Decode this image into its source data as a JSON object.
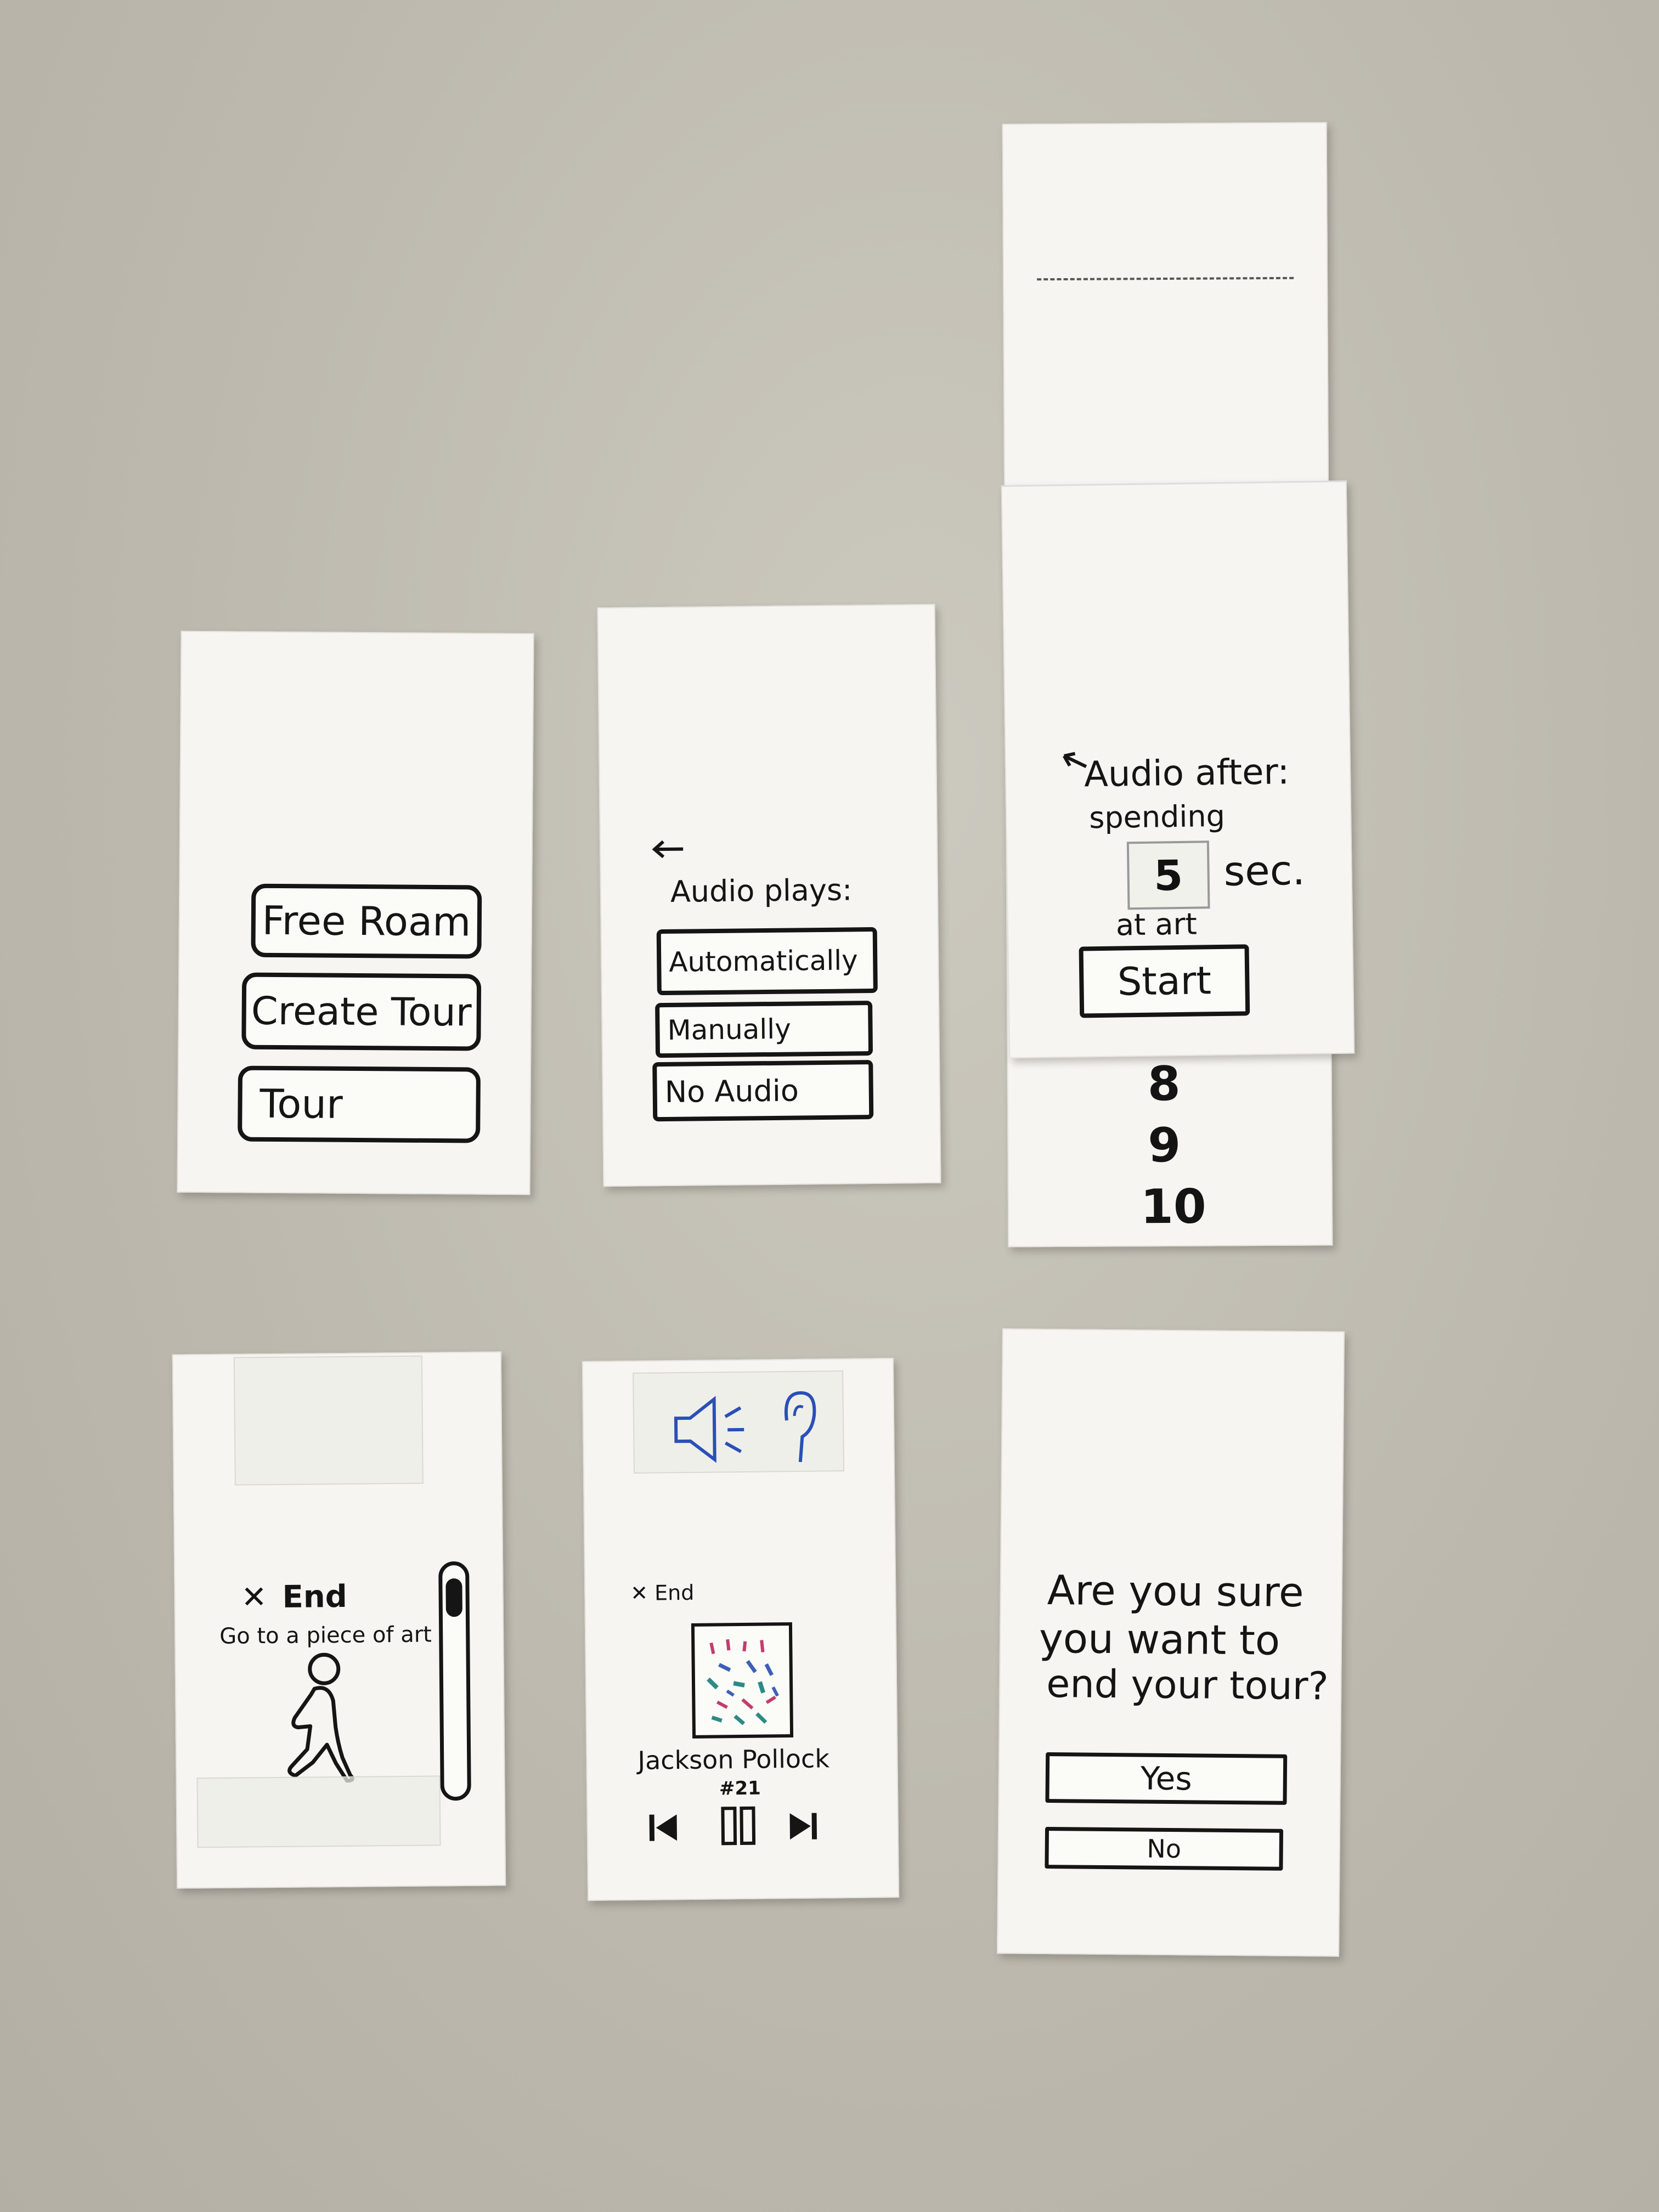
{
  "home": {
    "free_roam": "Free Roam",
    "create_tour": "Create Tour",
    "tour": "Tour"
  },
  "audio_settings": {
    "back_icon": "back-arrow-icon",
    "title": "Audio plays:",
    "options": [
      "Automatically",
      "Manually",
      "No Audio"
    ]
  },
  "timer_settings": {
    "back_icon": "back-arrow-icon",
    "line1": "Audio after:",
    "line2": "spending",
    "seconds_value": "5",
    "unit": "sec.",
    "line3": "at art",
    "start": "Start",
    "picker_values": [
      "8",
      "9",
      "10"
    ]
  },
  "navigate": {
    "end": "End",
    "instruction": "Go to a piece of art",
    "icon": "walking-person-icon"
  },
  "player": {
    "end": "End",
    "artist": "Jackson Pollock",
    "title": "#21",
    "icons": [
      "speaker-icon",
      "ear-icon",
      "previous-icon",
      "pause-icon",
      "next-icon"
    ]
  },
  "confirm": {
    "question_line1": "Are you sure",
    "question_line2": "you want to",
    "question_line3": "end your tour?",
    "yes": "Yes",
    "no": "No"
  }
}
